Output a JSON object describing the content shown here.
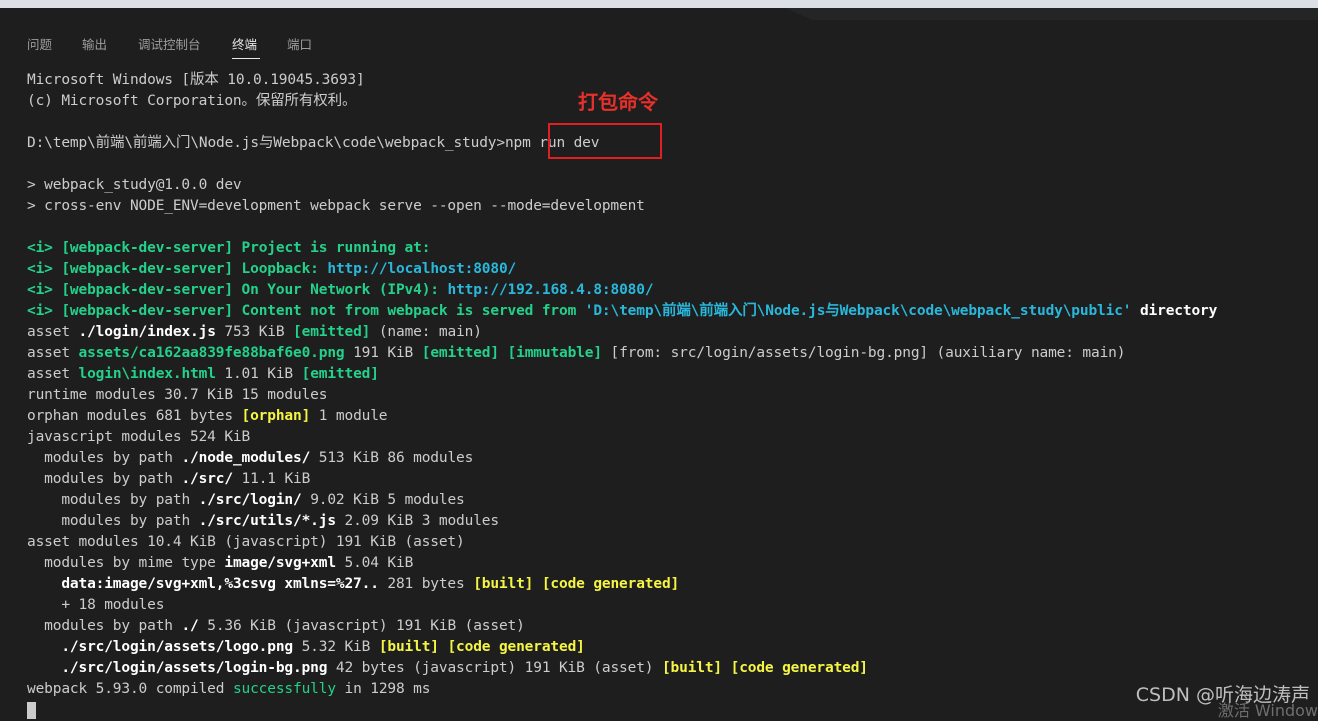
{
  "panel": {
    "tabs": [
      {
        "label": "问题"
      },
      {
        "label": "输出"
      },
      {
        "label": "调试控制台"
      },
      {
        "label": "终端"
      },
      {
        "label": "端口"
      }
    ],
    "active_tab": "终端"
  },
  "annotation": {
    "label": "打包命令",
    "color": "#e02020"
  },
  "terminal": {
    "line1": "Microsoft Windows [版本 10.0.19045.3693]",
    "line2": "(c) Microsoft Corporation。保留所有权利。",
    "prompt": "D:\\temp\\前端\\前端入门\\Node.js与Webpack\\code\\webpack_study>",
    "command": "npm run dev",
    "script1": "> webpack_study@1.0.0 dev",
    "script2": "> cross-env NODE_ENV=development webpack serve --open --mode=development",
    "i": "<i>",
    "wds": "[webpack-dev-server]",
    "running": "Project is running at:",
    "loopback_label": "Loopback:",
    "loopback_url": "http://localhost:8080/",
    "network_label": "On Your Network (IPv4):",
    "network_url": "http://192.168.4.8:8080/",
    "content_label": "Content not from webpack is served from",
    "content_path": "'D:\\temp\\前端\\前端入门\\Node.js与Webpack\\code\\webpack_study\\public'",
    "directory": "directory",
    "asset": "asset",
    "a1_path": "./login/index.js",
    "a1_size": "753 KiB",
    "emitted": "[emitted]",
    "a1_rest": "(name: main)",
    "a2_path": "assets/ca162aa839fe88baf6e0.png",
    "a2_size": "191 KiB",
    "immutable": "[immutable]",
    "a2_rest": "[from: src/login/assets/login-bg.png] (auxiliary name: main)",
    "a3_path": "login\\index.html",
    "a3_size": "1.01 KiB",
    "runtime": "runtime modules 30.7 KiB 15 modules",
    "orphan1": "orphan modules 681 bytes",
    "orphan_tag": "[orphan]",
    "orphan2": "1 module",
    "js": "javascript modules 524 KiB",
    "mbp": "modules by path",
    "nm_path": "./node_modules/",
    "nm_rest": "513 KiB 86 modules",
    "src_path": "./src/",
    "src_rest": "11.1 KiB",
    "login_path": "./src/login/",
    "login_rest": "9.02 KiB 5 modules",
    "utils_path": "./src/utils/*.js",
    "utils_rest": "2.09 KiB 3 modules",
    "asset_modules": "asset modules 10.4 KiB (javascript) 191 KiB (asset)",
    "mime_label": "modules by mime type",
    "mime_type": "image/svg+xml",
    "mime_rest": "5.04 KiB",
    "data_uri": "data:image/svg+xml,%3csvg xmlns=%27..",
    "data_rest": "281 bytes",
    "built": "[built]",
    "codegen": "[code generated]",
    "more": "+ 18 modules",
    "root_path": "./",
    "root_rest": "5.36 KiB (javascript) 191 KiB (asset)",
    "logo_path": "./src/login/assets/logo.png",
    "logo_rest": "5.32 KiB",
    "bg_path": "./src/login/assets/login-bg.png",
    "bg_rest": "42 bytes (javascript) 191 KiB (asset)",
    "compiled1": "webpack 5.93.0 compiled",
    "successfully": "successfully",
    "compiled2": "in 1298 ms"
  },
  "watermark": "CSDN @听海边涛声",
  "activation": "激活 Window"
}
